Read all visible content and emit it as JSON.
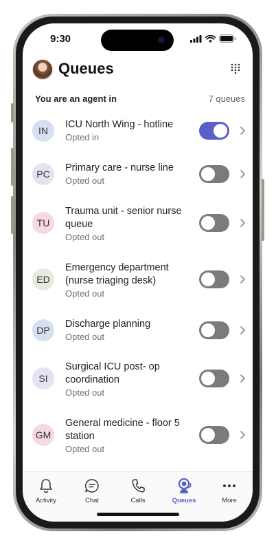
{
  "status_bar": {
    "time": "9:30"
  },
  "header": {
    "title": "Queues"
  },
  "section": {
    "title": "You are an agent in",
    "count": "7 queues"
  },
  "colors": {
    "accent": "#5b5fc7",
    "toggle_off": "#7b7b7b"
  },
  "queues": [
    {
      "initials": "IN",
      "name": "ICU North Wing - hotline",
      "status": "Opted in",
      "on": true,
      "avatar_bg": "#d6e0f0"
    },
    {
      "initials": "PC",
      "name": "Primary care - nurse line",
      "status": "Opted out",
      "on": false,
      "avatar_bg": "#e6e2f1"
    },
    {
      "initials": "TU",
      "name": "Trauma unit - senior nurse queue",
      "status": "Opted out",
      "on": false,
      "avatar_bg": "#f6d9e2"
    },
    {
      "initials": "ED",
      "name": "Emergency department (nurse triaging desk)",
      "status": "Opted out",
      "on": false,
      "avatar_bg": "#e3ecdd"
    },
    {
      "initials": "DP",
      "name": "Discharge planning",
      "status": "Opted out",
      "on": false,
      "avatar_bg": "#d6e0f0"
    },
    {
      "initials": "SI",
      "name": "Surgical ICU post- op coordination",
      "status": "Opted out",
      "on": false,
      "avatar_bg": "#e6e2f1"
    },
    {
      "initials": "GM",
      "name": "General medicine - floor 5 station",
      "status": "Opted out",
      "on": false,
      "avatar_bg": "#f6d9e2"
    }
  ],
  "tabs": [
    {
      "label": "Activity",
      "icon": "bell-icon",
      "active": false
    },
    {
      "label": "Chat",
      "icon": "chat-icon",
      "active": false
    },
    {
      "label": "Calls",
      "icon": "phone-icon",
      "active": false
    },
    {
      "label": "Queues",
      "icon": "queue-agent-icon",
      "active": true
    },
    {
      "label": "More",
      "icon": "more-icon",
      "active": false
    }
  ]
}
